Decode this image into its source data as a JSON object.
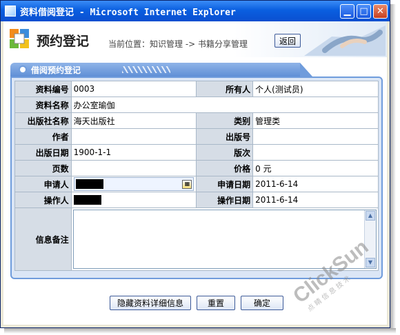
{
  "window": {
    "title": "资料借阅登记 - Microsoft Internet Explorer"
  },
  "header": {
    "title": "预约登记",
    "breadcrumb": "当前位置：知识管理 -> 书籍分享管理",
    "back_label": "返回"
  },
  "panel": {
    "title": "借阅预约登记"
  },
  "form": {
    "doc_no_label": "资料编号",
    "doc_no": "0003",
    "owner_label": "所有人",
    "owner": "个人(测试员)",
    "doc_name_label": "资料名称",
    "doc_name": "办公室瑜伽",
    "publisher_label": "出版社名称",
    "publisher": "海天出版社",
    "category_label": "类别",
    "category": "管理类",
    "author_label": "作者",
    "author": "",
    "pub_no_label": "出版号",
    "pub_no": "",
    "pub_date_label": "出版日期",
    "pub_date": "1900-1-1",
    "edition_label": "版次",
    "edition": "",
    "pages_label": "页数",
    "pages": "",
    "price_label": "价格",
    "price": "0 元",
    "applicant_label": "申请人",
    "apply_date_label": "申请日期",
    "apply_date": "2011-6-14",
    "operator_label": "操作人",
    "op_date_label": "操作日期",
    "op_date": "2011-6-14",
    "notes_label": "信息备注",
    "notes": ""
  },
  "actions": {
    "hide_details": "隐藏资料详细信息",
    "reset": "重置",
    "confirm": "确定"
  },
  "watermark": {
    "brand": "ClickSun",
    "tagline": "点睛信息技术"
  },
  "colors": {
    "titlebar": "#0a5fe0",
    "panel_border": "#6f9cdc",
    "label_bg": "#d6dde6"
  }
}
